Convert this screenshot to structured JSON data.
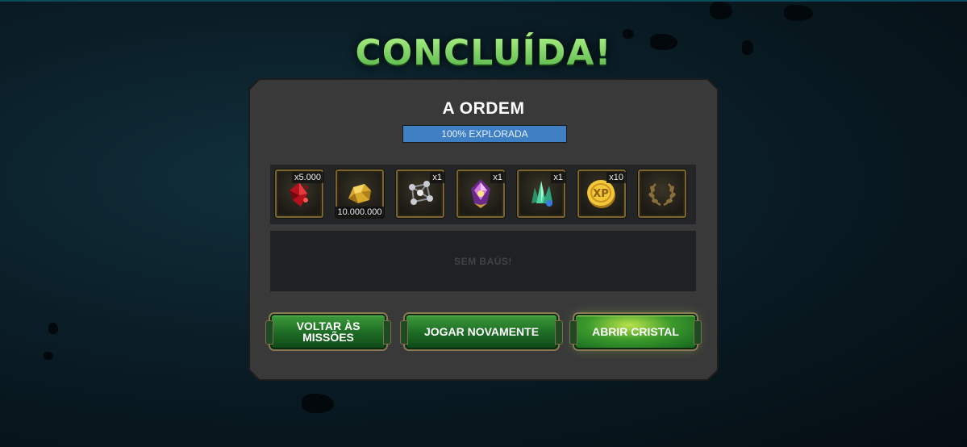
{
  "screen": {
    "title": "CONCLUÍDA!",
    "quest_name": "A ORDEM",
    "exploration": {
      "percent": 100,
      "label": "100% EXPLORADA"
    }
  },
  "rewards": [
    {
      "icon": "red-crystal-shard-icon",
      "qty": "x5.000",
      "qty_pos": "top"
    },
    {
      "icon": "gold-nugget-icon",
      "qty": "10.000.000",
      "qty_pos": "bottom"
    },
    {
      "icon": "molecule-catalyst-icon",
      "qty": "x1",
      "qty_pos": "top"
    },
    {
      "icon": "cosmic-crystal-icon",
      "qty": "x1",
      "qty_pos": "top"
    },
    {
      "icon": "green-crystal-cluster-icon",
      "qty": "x1",
      "qty_pos": "top"
    },
    {
      "icon": "xp-coin-icon",
      "qty": "x10",
      "qty_pos": "top"
    },
    {
      "icon": "laurel-wreath-icon",
      "qty": "",
      "qty_pos": "none"
    }
  ],
  "chests": {
    "empty_text": "SEM BAÚS!"
  },
  "buttons": {
    "back": "VOLTAR ÀS MISSÕES",
    "replay": "JOGAR NOVAMENTE",
    "open_crystal": "ABRIR CRISTAL"
  },
  "colors": {
    "title_green": "#86de6a",
    "progress_blue": "#3f7fc4",
    "button_green": "#1d6b24",
    "slot_gold": "#7a6430"
  }
}
